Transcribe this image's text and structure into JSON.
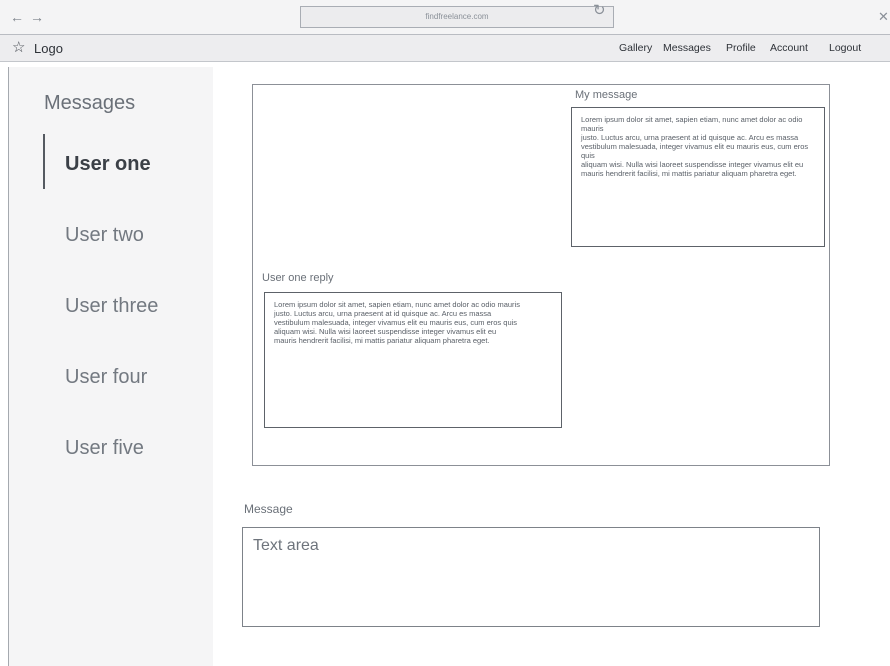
{
  "browser": {
    "back_icon": "←",
    "forward_icon": "→",
    "url": "findfreelance.com",
    "reload_icon": "↻",
    "close_icon": "✕"
  },
  "header": {
    "logo_icon": "☆",
    "logo_label": "Logo",
    "nav": [
      "Gallery",
      "Messages",
      "Profile",
      "Account",
      "Logout"
    ]
  },
  "sidebar": {
    "title": "Messages",
    "users": [
      "User one",
      "User two",
      "User three",
      "User four",
      "User five"
    ],
    "active_user": "User one"
  },
  "conversation": {
    "my_message_label": "My message",
    "my_message_text": "Lorem ipsum dolor sit amet, sapien etiam, nunc amet dolor ac odio mauris\n justo. Luctus arcu, urna praesent at id quisque ac. Arcu es massa\nvestibulum malesuada, integer vivamus elit eu mauris eus, cum eros quis\naliquam wisi. Nulla wisi laoreet suspendisse integer vivamus elit eu\nmauris hendrerit facilisi, mi mattis pariatur aliquam pharetra eget.",
    "reply_label": "User one reply",
    "reply_text": "Lorem ipsum dolor sit amet, sapien etiam, nunc amet dolor ac odio mauris\n justo. Luctus arcu, urna praesent at id quisque ac. Arcu es massa\nvestibulum malesuada, integer vivamus elit eu mauris eus, cum eros quis\naliquam wisi. Nulla wisi laoreet suspendisse integer vivamus elit eu\nmauris hendrerit facilisi, mi mattis pariatur aliquam pharetra eget."
  },
  "composer": {
    "label": "Message",
    "placeholder": "Text area"
  }
}
